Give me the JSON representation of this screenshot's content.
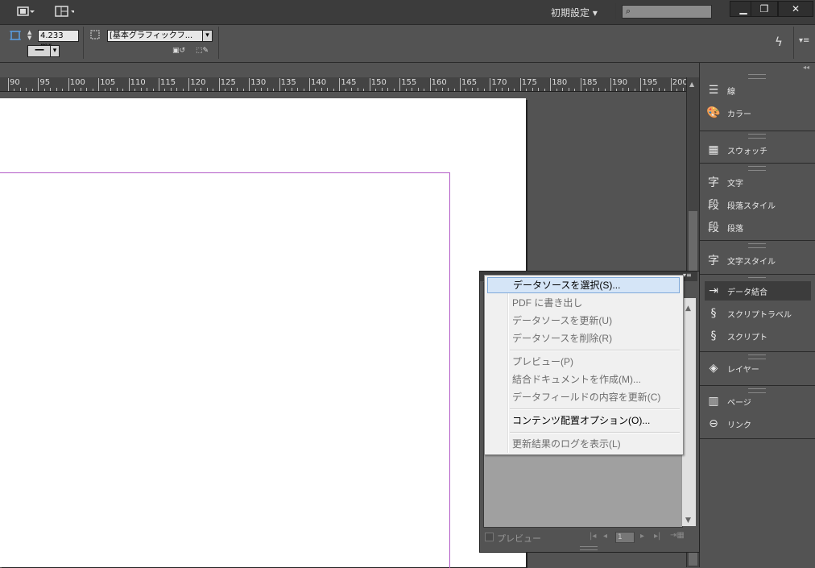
{
  "topbar": {
    "screen_mode_icon": "screen-mode-icon",
    "arrange_icon": "arrange-documents-icon",
    "workspace_label": "初期設定 ▾",
    "search_placeholder": "",
    "minimize": "▁",
    "restore": "❐",
    "close": "✕"
  },
  "control": {
    "stroke_weight": "4.233 mr",
    "object_style": "[基本グラフィックフ...",
    "dropdown_arrow": "▾"
  },
  "ruler": {
    "labels": [
      "90",
      "95",
      "100",
      "105",
      "110",
      "115",
      "120",
      "125",
      "130",
      "135",
      "140",
      "145",
      "150",
      "155",
      "160",
      "165",
      "170",
      "175",
      "180",
      "185",
      "190",
      "195",
      "200"
    ]
  },
  "panels": {
    "items": [
      {
        "label": "線",
        "icon": "stroke-icon"
      },
      {
        "label": "カラー",
        "icon": "color-icon"
      },
      {
        "label": "スウォッチ",
        "icon": "swatches-icon"
      },
      {
        "label": "文字",
        "icon": "character-icon"
      },
      {
        "label": "段落スタイル",
        "icon": "paragraph-styles-icon"
      },
      {
        "label": "段落",
        "icon": "paragraph-icon"
      },
      {
        "label": "文字スタイル",
        "icon": "character-styles-icon"
      },
      {
        "label": "データ結合",
        "icon": "data-merge-icon"
      },
      {
        "label": "スクリプトラベル",
        "icon": "script-label-icon"
      },
      {
        "label": "スクリプト",
        "icon": "scripts-icon"
      },
      {
        "label": "レイヤー",
        "icon": "layers-icon"
      },
      {
        "label": "ページ",
        "icon": "pages-icon"
      },
      {
        "label": "リンク",
        "icon": "links-icon"
      }
    ]
  },
  "data_merge": {
    "preview_label": "プレビュー",
    "page_number": "1"
  },
  "menu": {
    "items": [
      {
        "label": "データソースを選択(S)...",
        "state": "highlighted"
      },
      {
        "label": "PDF に書き出し",
        "state": "disabled"
      },
      {
        "label": "データソースを更新(U)",
        "state": "disabled"
      },
      {
        "label": "データソースを削除(R)",
        "state": "disabled"
      },
      {
        "label": "プレビュー(P)",
        "state": "disabled"
      },
      {
        "label": "結合ドキュメントを作成(M)...",
        "state": "disabled"
      },
      {
        "label": "データフィールドの内容を更新(C)",
        "state": "disabled"
      },
      {
        "label": "コンテンツ配置オプション(O)...",
        "state": "enabled"
      },
      {
        "label": "更新結果のログを表示(L)",
        "state": "disabled"
      }
    ]
  },
  "colors": {
    "margin_guide": "#b35bc7",
    "menu_highlight": "#d5e5f7"
  }
}
